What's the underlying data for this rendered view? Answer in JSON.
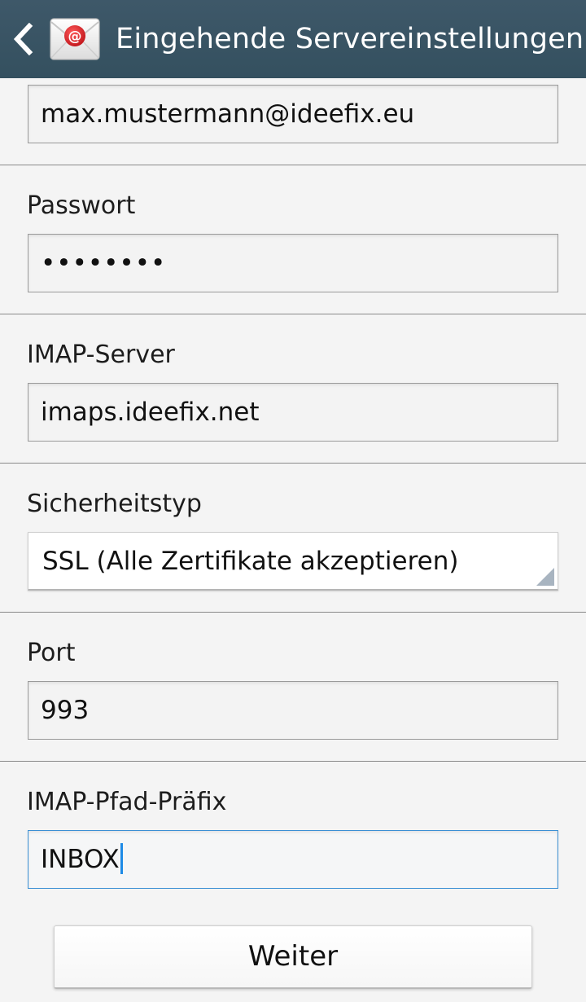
{
  "header": {
    "title": "Eingehende Servereinstellungen",
    "back_icon": "chevron-left-icon",
    "app_icon": "email-app-icon",
    "colors": {
      "bar": "#3e5869",
      "title": "#ffffff"
    }
  },
  "form": {
    "username": {
      "value": "max.mustermann@ideefix.eu"
    },
    "password": {
      "label": "Passwort",
      "value": "••••••••"
    },
    "imap_server": {
      "label": "IMAP-Server",
      "value": "imaps.ideefix.net"
    },
    "security_type": {
      "label": "Sicherheitstyp",
      "value": "SSL (Alle Zertifikate akzeptieren)"
    },
    "port": {
      "label": "Port",
      "value": "993"
    },
    "imap_prefix": {
      "label": "IMAP-Pfad-Präfix",
      "value": "INBOX"
    }
  },
  "actions": {
    "next_label": "Weiter"
  },
  "colors": {
    "focus_border": "#3a8fd4",
    "caret": "#1e8ae6"
  }
}
